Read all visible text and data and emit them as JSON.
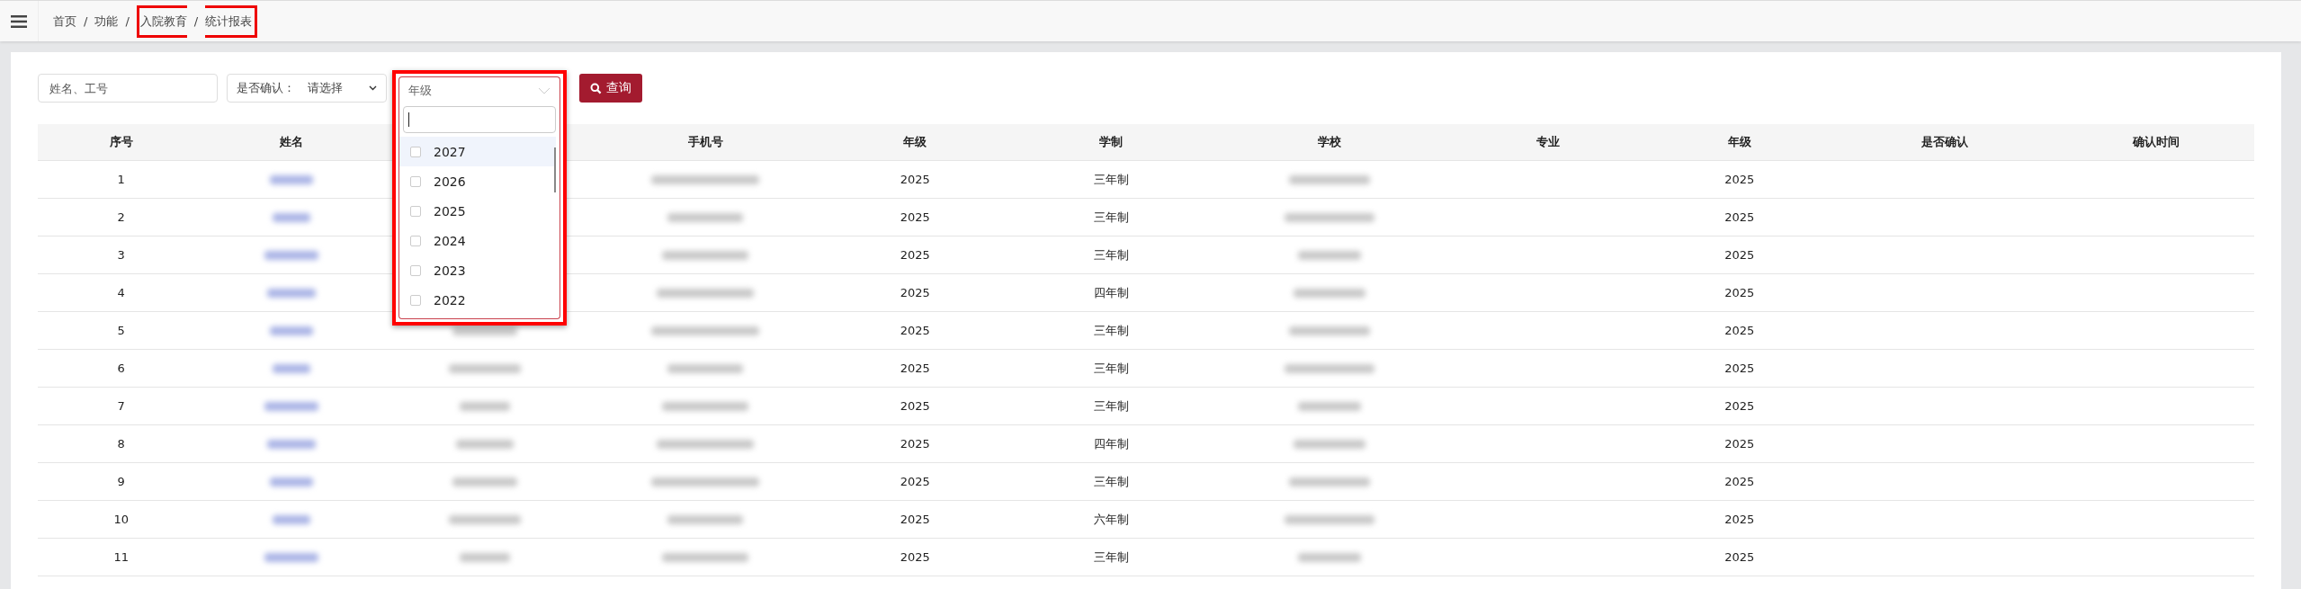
{
  "topbar": {
    "breadcrumb": {
      "highlighted": true,
      "items": [
        "首页",
        "功能",
        "入院教育",
        "统计报表"
      ],
      "separator": "/"
    }
  },
  "filters": {
    "search": {
      "placeholder": "姓名、工号"
    },
    "confirm_select": {
      "label": "是否确认：",
      "value": "请选择"
    },
    "grade_select": {
      "placeholder": "年级",
      "expanded": true,
      "highlighted": true,
      "options": [
        {
          "label": "2027",
          "checked": false,
          "hovered": true
        },
        {
          "label": "2026",
          "checked": false,
          "hovered": false
        },
        {
          "label": "2025",
          "checked": false,
          "hovered": false
        },
        {
          "label": "2024",
          "checked": false,
          "hovered": false
        },
        {
          "label": "2023",
          "checked": false,
          "hovered": false
        },
        {
          "label": "2022",
          "checked": false,
          "hovered": false
        }
      ]
    },
    "query_button": {
      "label": "查询"
    }
  },
  "table": {
    "columns": [
      {
        "label": "序号",
        "kind": "text"
      },
      {
        "label": "姓名",
        "kind": "blurred-name"
      },
      {
        "kind": "blurred"
      },
      {
        "label": "手机号",
        "kind": "blurred"
      },
      {
        "label": "年级",
        "kind": "text"
      },
      {
        "label": "学制",
        "kind": "text"
      },
      {
        "label": "学校",
        "kind": "blurred"
      },
      {
        "label": "专业",
        "kind": "text"
      },
      {
        "label": "年级",
        "kind": "text"
      },
      {
        "label": "是否确认",
        "kind": "text"
      },
      {
        "label": "确认时间",
        "kind": "text"
      }
    ],
    "rows": [
      [
        "1",
        null,
        "",
        null,
        "2025",
        "三年制",
        null,
        "",
        "2025",
        "",
        ""
      ],
      [
        "2",
        null,
        "",
        null,
        "2025",
        "三年制",
        null,
        "",
        "2025",
        "",
        ""
      ],
      [
        "3",
        null,
        "",
        null,
        "2025",
        "三年制",
        null,
        "",
        "2025",
        "",
        ""
      ],
      [
        "4",
        null,
        "",
        null,
        "2025",
        "四年制",
        null,
        "",
        "2025",
        "",
        ""
      ],
      [
        "5",
        null,
        null,
        null,
        "2025",
        "三年制",
        null,
        "",
        "2025",
        "",
        ""
      ],
      [
        "6",
        null,
        null,
        null,
        "2025",
        "三年制",
        null,
        "",
        "2025",
        "",
        ""
      ],
      [
        "7",
        null,
        null,
        null,
        "2025",
        "三年制",
        null,
        "",
        "2025",
        "",
        ""
      ],
      [
        "8",
        null,
        null,
        null,
        "2025",
        "四年制",
        null,
        "",
        "2025",
        "",
        ""
      ],
      [
        "9",
        null,
        null,
        null,
        "2025",
        "三年制",
        null,
        "",
        "2025",
        "",
        ""
      ],
      [
        "10",
        null,
        null,
        null,
        "2025",
        "六年制",
        null,
        "",
        "2025",
        "",
        ""
      ],
      [
        "11",
        null,
        null,
        null,
        "2025",
        "三年制",
        null,
        "",
        "2025",
        "",
        ""
      ]
    ]
  }
}
